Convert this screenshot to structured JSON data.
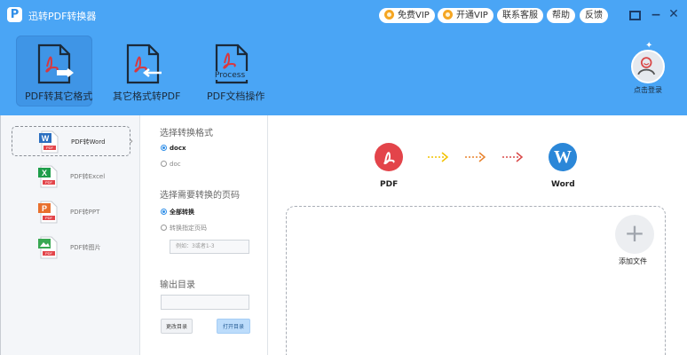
{
  "window": {
    "logo_glyph": "P",
    "title": "迅转PDF转换器",
    "free_vip": "免费VIP",
    "open_vip": "开通VIP",
    "support": "联系客服",
    "help": "帮助",
    "feedback": "反馈"
  },
  "toolbar": {
    "items": [
      {
        "label": "PDF转其它格式",
        "icon": "pdf-export-icon"
      },
      {
        "label": "其它格式转PDF",
        "icon": "pdf-import-icon"
      },
      {
        "label": "PDF文档操作",
        "icon": "pdf-process-icon",
        "badge": "Process"
      }
    ],
    "login_label": "点击登录"
  },
  "sidebar": {
    "items": [
      {
        "label": "PDF转Word",
        "icon": "word-file-icon",
        "glyph": "W",
        "sub": "PDF"
      },
      {
        "label": "PDF转Excel",
        "icon": "excel-file-icon",
        "glyph": "X",
        "sub": "PDF"
      },
      {
        "label": "PDF转PPT",
        "icon": "ppt-file-icon",
        "glyph": "P",
        "sub": "PDF"
      },
      {
        "label": "PDF转图片",
        "icon": "image-file-icon",
        "glyph": "",
        "sub": "PDF"
      }
    ]
  },
  "options": {
    "format_heading": "选择转换格式",
    "format_docx": "docx",
    "format_doc": "doc",
    "pages_heading": "选择需要转换的页码",
    "pages_all": "全部转换",
    "pages_specific": "转换指定页码",
    "pages_placeholder": "例如：3或者1-3",
    "output_heading": "输出目录",
    "output_value": "",
    "change_dir": "更改目录",
    "open_dir": "打开目录"
  },
  "main": {
    "from_label": "PDF",
    "to_label": "Word",
    "word_glyph": "W",
    "add_label": "添加文件"
  },
  "colors": {
    "accent": "#4aa5f5",
    "pdf_red": "#e3444a",
    "word_blue": "#2b87d8",
    "excel_green": "#1e9e4a",
    "ppt_orange": "#e8702e",
    "arrow_yellow": "#f2c200",
    "arrow_orange": "#e8832e",
    "arrow_red": "#d94848"
  }
}
